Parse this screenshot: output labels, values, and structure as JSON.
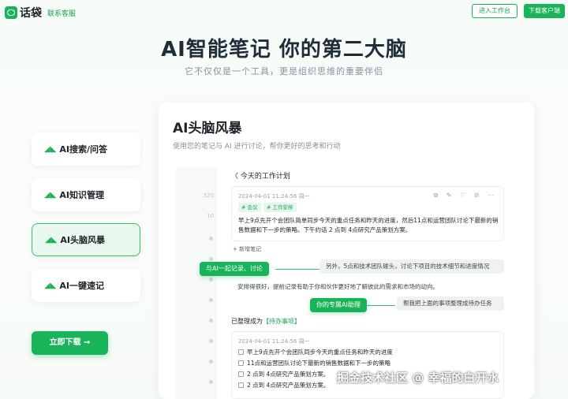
{
  "header": {
    "logo_text": "话袋",
    "nav_link": "联系客服",
    "workspace_btn": "进入工作台",
    "download_btn": "下载客户端"
  },
  "hero": {
    "title": "AI智能笔记 你的第二大脑",
    "subtitle": "它不仅仅是一个工具，更是组织思维的重要伴侣"
  },
  "sidebar": {
    "items": [
      {
        "label": "AI搜索/问答",
        "active": false
      },
      {
        "label": "AI知识管理",
        "active": false
      },
      {
        "label": "AI头脑风暴",
        "active": true
      },
      {
        "label": "AI一键速记",
        "active": false
      }
    ],
    "download_btn": "立即下载 →"
  },
  "panel": {
    "title": "AI头脑风暴",
    "subtitle": "使用您的笔记与 AI 进行讨论，帮你更好的思考和行动",
    "gutter_numbers": [
      "320",
      "10"
    ],
    "note": {
      "header": "〈  今天的工作计划",
      "meta": "2024-04-01   11:24:56   周一",
      "icons": "⧉ ✎ ♡ ⊘ ⋯",
      "tags": [
        "# 会议",
        "# 工作安排"
      ],
      "body": "早上9点先开个会团队简单同步今天的重点任务和昨天的进度，然后11点和运营团队讨论下最新的销售数据和下一步的策略。下午约话 2 点到 4点研究产品策划方案。"
    },
    "add_note": "+ 新增笔记",
    "chat": {
      "user_bubble": "与AI一起记录、讨论",
      "ai_reply": "另外，5点和技术团队碰头，讨论下项目的技术细节和进度情况",
      "plain_line": "安排得很好，提前记录有助于你和伙伴更好地了解彼此的需求和市场的动向。",
      "assistant_bubble": "你的专属AI助理",
      "user_request": "帮我把上面的事项整理成待办任务"
    },
    "todo": {
      "prefix": "已整理成为",
      "label": "【待办事项】",
      "meta": "2024-04-01   11:24:56   周一",
      "items": [
        "早上9点先开个会团队同步今天的重点任务和昨天的进度",
        "11点和运营团队讨论下最新的销售数据和下一步的策略",
        "2 点到 4点研究产品策划方案。",
        "2 点到 4点研究产品策划方案。"
      ]
    }
  },
  "watermark": "掘金技术社区 @ 幸福的白开水",
  "colors": {
    "accent": "#19b35a",
    "accent_light": "#e9f8ee",
    "title": "#1f2d3a"
  }
}
